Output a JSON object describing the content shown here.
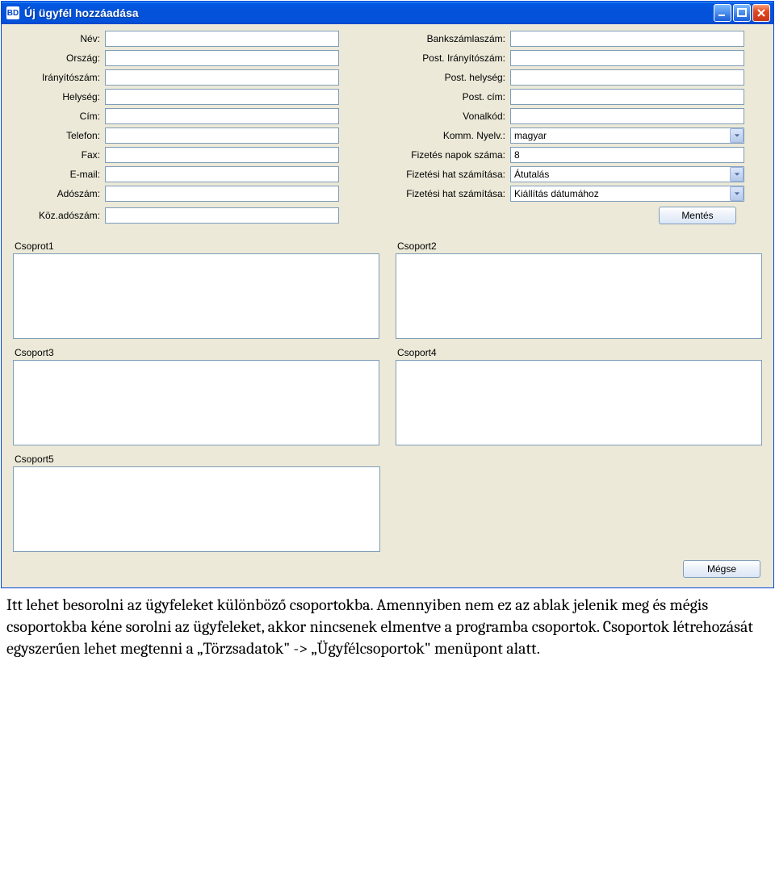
{
  "window": {
    "title": "Új ügyfél hozzáadása",
    "icon_text": "BD"
  },
  "form": {
    "left": {
      "nev": {
        "label": "Név:",
        "value": ""
      },
      "orszag": {
        "label": "Ország:",
        "value": ""
      },
      "iranyitoszam": {
        "label": "Irányítószám:",
        "value": ""
      },
      "helyseg": {
        "label": "Helység:",
        "value": ""
      },
      "cim": {
        "label": "Cím:",
        "value": ""
      },
      "telefon": {
        "label": "Telefon:",
        "value": ""
      },
      "fax": {
        "label": "Fax:",
        "value": ""
      },
      "email": {
        "label": "E-mail:",
        "value": ""
      },
      "adoszam": {
        "label": "Adószám:",
        "value": ""
      },
      "koz_adoszam": {
        "label": "Köz.adószám:",
        "value": ""
      }
    },
    "right": {
      "bankszamla": {
        "label": "Bankszámlaszám:",
        "value": ""
      },
      "post_irsz": {
        "label": "Post. Irányítószám:",
        "value": ""
      },
      "post_helyseg": {
        "label": "Post. helység:",
        "value": ""
      },
      "post_cim": {
        "label": "Post. cím:",
        "value": ""
      },
      "vonalkod": {
        "label": "Vonalkód:",
        "value": ""
      },
      "komm_nyelv": {
        "label": "Komm. Nyelv.:",
        "value": "magyar"
      },
      "fizetes_napok": {
        "label": "Fizetés napok száma:",
        "value": "8"
      },
      "fizhat1": {
        "label": "Fizetési hat számítása:",
        "value": "Átutalás"
      },
      "fizhat2": {
        "label": "Fizetési hat számítása:",
        "value": "Kiállítás dátumához"
      }
    }
  },
  "buttons": {
    "save": "Mentés",
    "cancel": "Mégse"
  },
  "groups": {
    "g1": "Csoprot1",
    "g2": "Csoport2",
    "g3": "Csoport3",
    "g4": "Csoport4",
    "g5": "Csoport5"
  },
  "help_text": "Itt lehet besorolni az ügyfeleket különböző csoportokba. Amennyiben nem ez az ablak jelenik meg és mégis csoportokba kéne sorolni az ügyfeleket, akkor nincsenek elmentve a programba csoportok. Csoportok létrehozását egyszerűen lehet megtenni a „Törzsadatok\" -> „Ügyfélcsoportok\" menüpont alatt."
}
